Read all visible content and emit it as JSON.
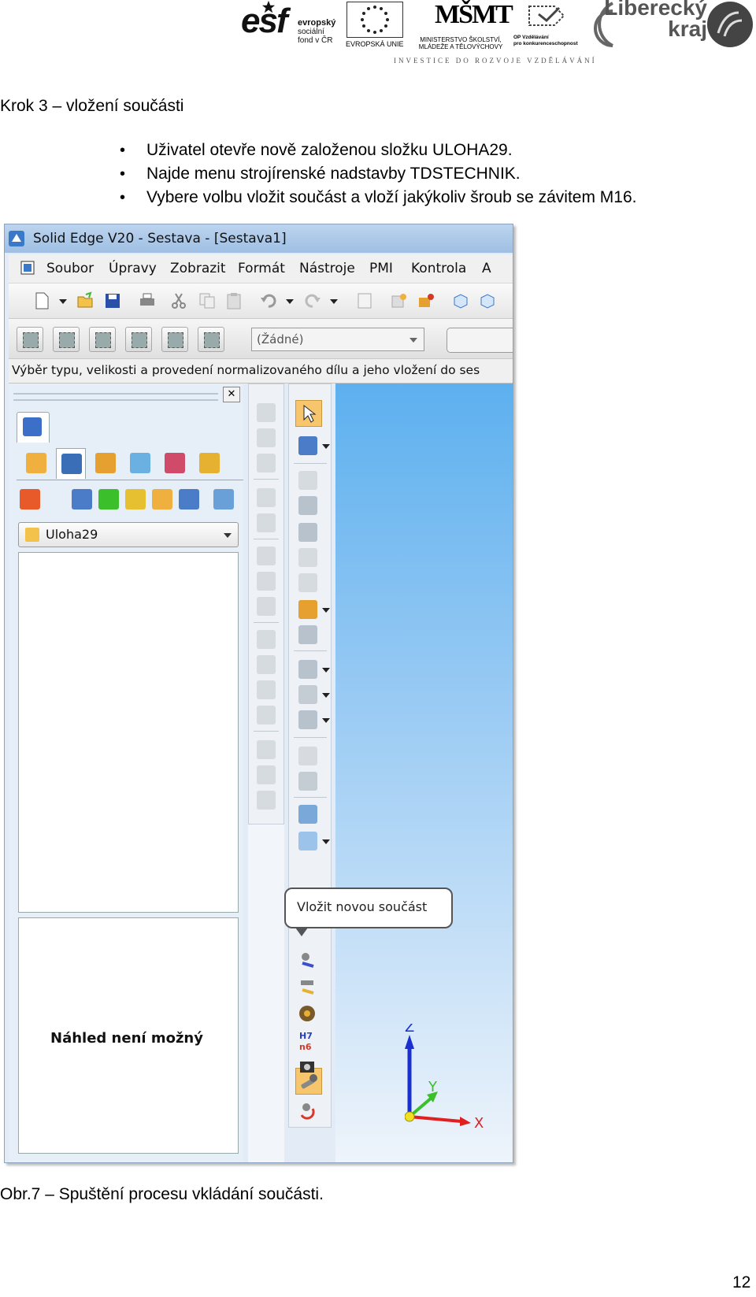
{
  "header": {
    "esf": {
      "mark": "esf",
      "line1": "evropský",
      "line2": "sociální",
      "line3": "fond v ČR"
    },
    "eu_caption": "EVROPSKÁ UNIE",
    "msmt": {
      "mark": "MŠMT",
      "line1": "MINISTERSTVO ŠKOLSTVÍ,",
      "line2": "MLÁDEŽE A TĚLOVÝCHOVY"
    },
    "op": {
      "line1": "OP Vzdělávání",
      "line2": "pro konkurenceschopnost"
    },
    "kraj": {
      "line1": "Liberecký",
      "line2": "kraj"
    },
    "tagline": "INVESTICE DO ROZVOJE VZDĚLÁVÁNÍ"
  },
  "step_heading": "Krok 3 – vložení součásti",
  "bullets": [
    "Uživatel otevře nově založenou složku ULOHA29.",
    "Najde menu strojírenské nadstavby TDSTECHNIK.",
    "Vybere volbu vložit součást a vloží jakýkoliv šroub se závitem M16."
  ],
  "screenshot": {
    "title": "Solid Edge V20 - Sestava - [Sestava1]",
    "menu": [
      "Soubor",
      "Úpravy",
      "Zobrazit",
      "Formát",
      "Nástroje",
      "PMI",
      "Kontrola",
      "A"
    ],
    "combo_value": "(Žádné)",
    "hint": "Výběr typu, velikosti a provedení normalizovaného dílu a jeho vložení do ses",
    "folder": "Uloha29",
    "preview_text": "Náhled není možný",
    "tooltip": "Vložit novou součást",
    "axes": {
      "z": "Z",
      "y": "Y",
      "x": "X"
    },
    "h7n6": {
      "top": "H7",
      "bottom": "n6"
    },
    "colors": {
      "viewport_top": "#5db0ef",
      "active_button": "#f7c66c",
      "axis_x": "#e02020",
      "axis_y": "#3bbf2a",
      "axis_z": "#1a2fd0"
    }
  },
  "caption": "Obr.7 – Spuštění procesu vkládání součásti.",
  "page_number": "12"
}
